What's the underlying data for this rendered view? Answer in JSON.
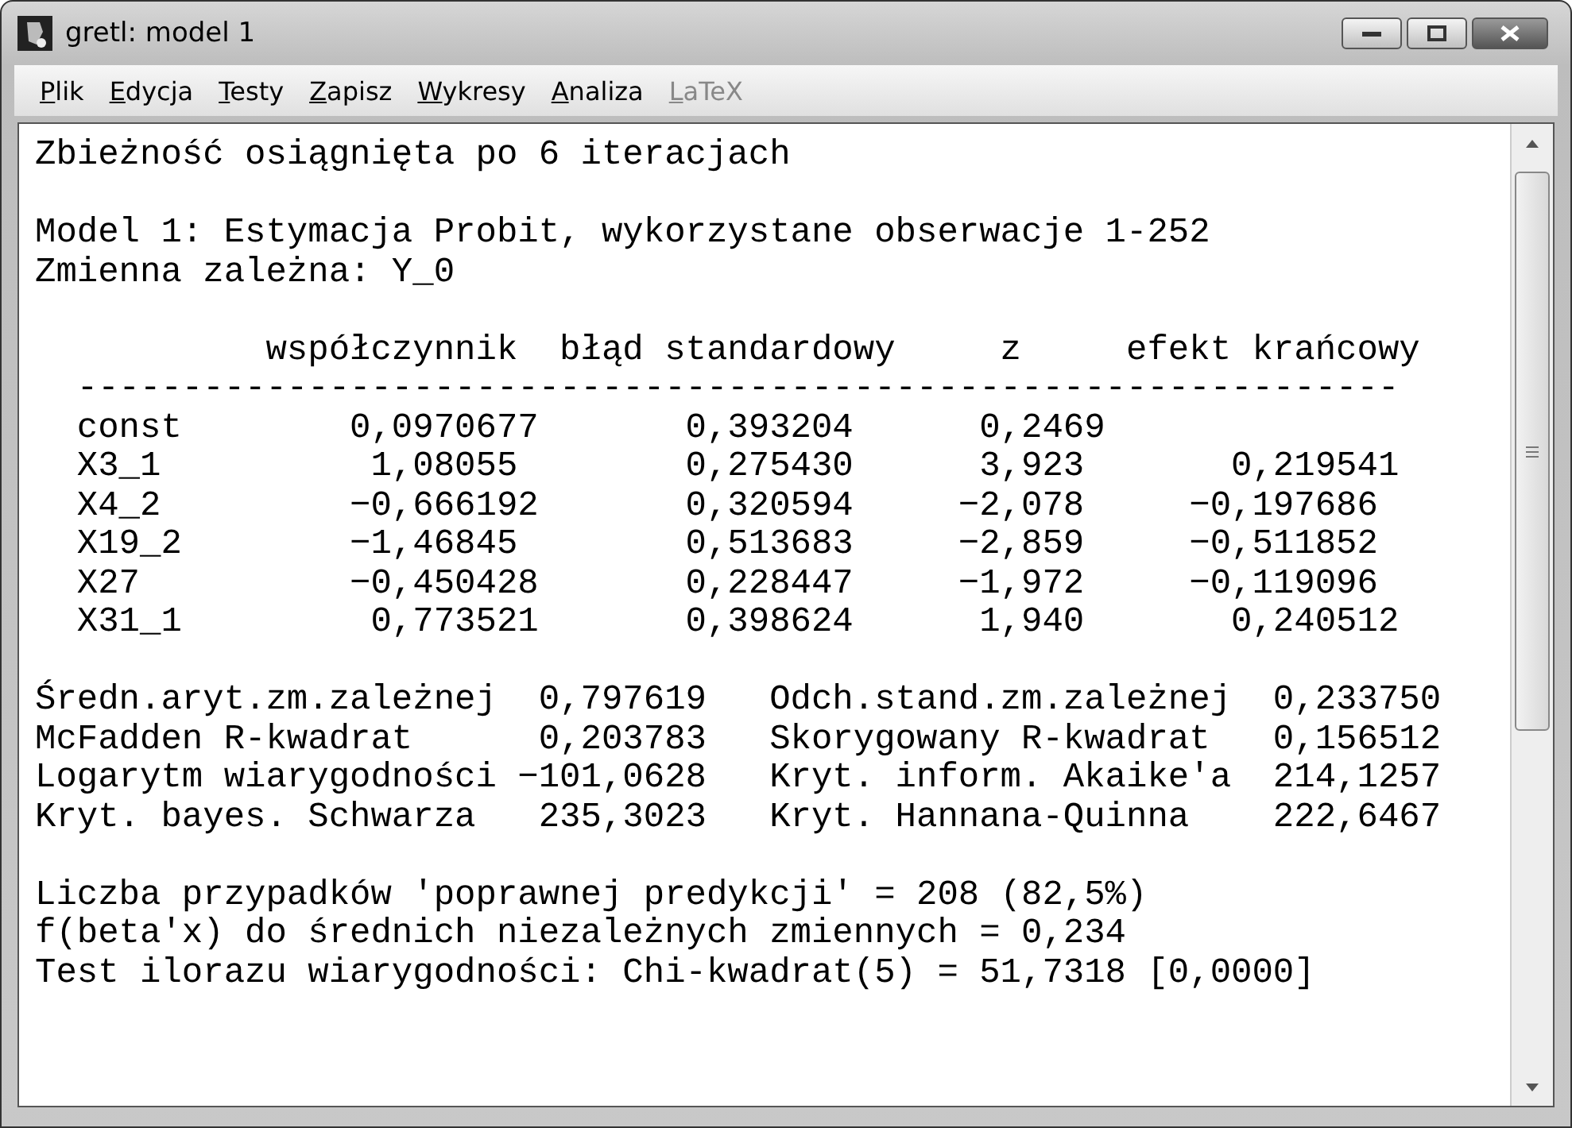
{
  "window": {
    "title": "gretl: model 1"
  },
  "menu": [
    {
      "label": "Plik",
      "disabled": false
    },
    {
      "label": "Edycja",
      "disabled": false
    },
    {
      "label": "Testy",
      "disabled": false
    },
    {
      "label": "Zapisz",
      "disabled": false
    },
    {
      "label": "Wykresy",
      "disabled": false
    },
    {
      "label": "Analiza",
      "disabled": false
    },
    {
      "label": "LaTeX",
      "disabled": true
    }
  ],
  "output": [
    [
      "Zbieżność osiągnięta po 6 iteracjach"
    ],
    [
      "Model 1: Estymacja Probit, wykorzystane obserwacje 1-252",
      "Zmienna zależna: Y_0"
    ],
    [
      "           współczynnik  błąd standardowy     z     efekt krańcowy",
      "  ---------------------------------------------------------------",
      "  const        0,0970677       0,393204      0,2469",
      "  X3_1          1,08055        0,275430      3,923       0,219541",
      "  X4_2         −0,666192       0,320594     −2,078     −0,197686",
      "  X19_2        −1,46845        0,513683     −2,859     −0,511852",
      "  X27          −0,450428       0,228447     −1,972     −0,119096",
      "  X31_1         0,773521       0,398624      1,940       0,240512"
    ],
    [
      "Średn.aryt.zm.zależnej  0,797619   Odch.stand.zm.zależnej  0,233750",
      "McFadden R-kwadrat      0,203783   Skorygowany R-kwadrat   0,156512",
      "Logarytm wiarygodności −101,0628   Kryt. inform. Akaike'a  214,1257",
      "Kryt. bayes. Schwarza   235,3023   Kryt. Hannana-Quinna    222,6467"
    ],
    [
      "Liczba przypadków 'poprawnej predykcji' = 208 (82,5%)",
      "f(beta'x) do średnich niezależnych zmiennych = 0,234",
      "Test ilorazu wiarygodności: Chi-kwadrat(5) = 51,7318 [0,0000]"
    ]
  ]
}
